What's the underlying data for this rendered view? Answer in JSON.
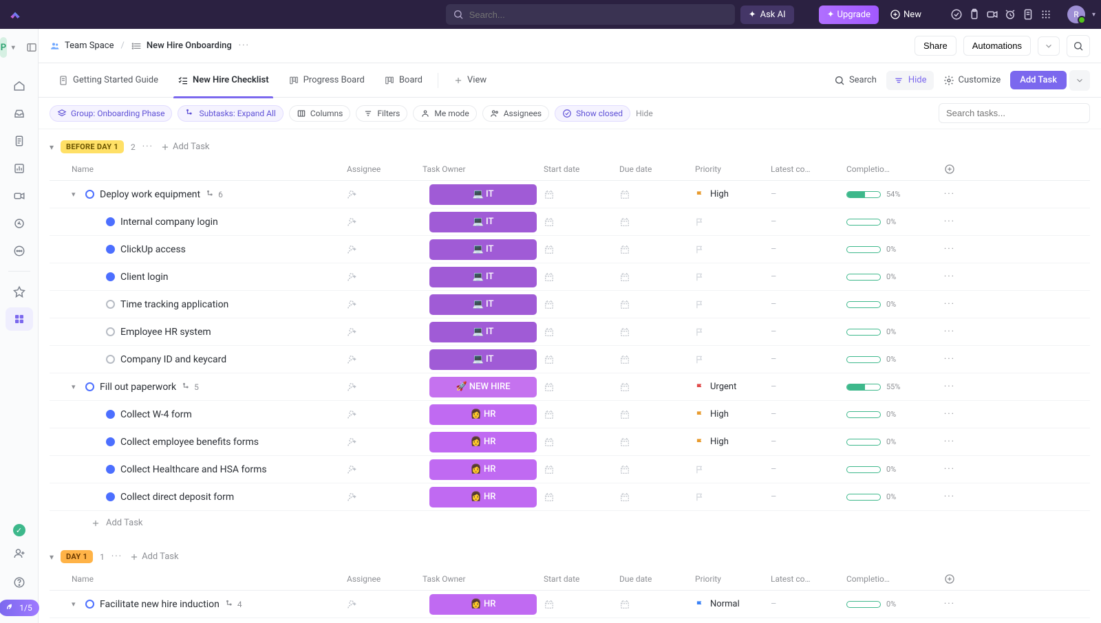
{
  "top": {
    "search_placeholder": "Search...",
    "ask_ai": "Ask AI",
    "upgrade": "Upgrade",
    "new": "New",
    "avatar_initial": "R"
  },
  "workspace_initial": "P",
  "breadcrumb": {
    "team_space": "Team Space",
    "list_name": "New Hire Onboarding",
    "share": "Share",
    "automations": "Automations"
  },
  "tabs": {
    "getting_started": "Getting Started Guide",
    "checklist": "New Hire Checklist",
    "progress_board": "Progress Board",
    "board": "Board",
    "view": "View",
    "search": "Search",
    "hide": "Hide",
    "customize": "Customize",
    "add_task": "Add Task"
  },
  "filters": {
    "group": "Group: Onboarding Phase",
    "subtasks": "Subtasks: Expand All",
    "columns": "Columns",
    "filters": "Filters",
    "me_mode": "Me mode",
    "assignees": "Assignees",
    "show_closed": "Show closed",
    "hide": "Hide",
    "search_placeholder": "Search tasks..."
  },
  "groups": [
    {
      "label": "BEFORE DAY 1",
      "badge_class": "",
      "count": "2",
      "add_task": "Add Task",
      "columns": {
        "name": "Name",
        "assignee": "Assignee",
        "owner": "Task Owner",
        "start": "Start date",
        "due": "Due date",
        "priority": "Priority",
        "latest": "Latest co…",
        "completion": "Completio…"
      },
      "rows": [
        {
          "indent": 0,
          "caret": true,
          "dot": "blue-ring",
          "name": "Deploy work equipment",
          "subcount": "6",
          "owner": "💻 IT",
          "owner_class": "owner-it",
          "flag": "orange",
          "prio": "High",
          "percent": 54
        },
        {
          "indent": 1,
          "dot": "blue-filled",
          "name": "Internal company login",
          "owner": "💻 IT",
          "owner_class": "owner-it",
          "flag": "empty",
          "percent": 0
        },
        {
          "indent": 1,
          "dot": "blue-filled",
          "name": "ClickUp access",
          "owner": "💻 IT",
          "owner_class": "owner-it",
          "flag": "empty",
          "percent": 0
        },
        {
          "indent": 1,
          "dot": "blue-filled",
          "name": "Client login",
          "owner": "💻 IT",
          "owner_class": "owner-it",
          "flag": "empty",
          "percent": 0
        },
        {
          "indent": 1,
          "dot": "grey",
          "name": "Time tracking application",
          "owner": "💻 IT",
          "owner_class": "owner-it",
          "flag": "empty",
          "percent": 0
        },
        {
          "indent": 1,
          "dot": "grey",
          "name": "Employee HR system",
          "owner": "💻 IT",
          "owner_class": "owner-it",
          "flag": "empty",
          "percent": 0
        },
        {
          "indent": 1,
          "dot": "grey",
          "name": "Company ID and keycard",
          "owner": "💻 IT",
          "owner_class": "owner-it",
          "flag": "empty",
          "percent": 0
        },
        {
          "indent": 0,
          "caret": true,
          "dot": "blue-ring",
          "name": "Fill out paperwork",
          "subcount": "5",
          "owner": "🚀 NEW HIRE",
          "owner_class": "owner-nh",
          "flag": "red",
          "prio": "Urgent",
          "percent": 55
        },
        {
          "indent": 1,
          "dot": "blue-filled",
          "name": "Collect W-4 form",
          "owner": "👩 HR",
          "owner_class": "owner-hr",
          "flag": "orange",
          "prio": "High",
          "percent": 0
        },
        {
          "indent": 1,
          "dot": "blue-filled",
          "name": "Collect employee benefits forms",
          "owner": "👩 HR",
          "owner_class": "owner-hr",
          "flag": "orange",
          "prio": "High",
          "percent": 0
        },
        {
          "indent": 1,
          "dot": "blue-filled",
          "name": "Collect Healthcare and HSA forms",
          "owner": "👩 HR",
          "owner_class": "owner-hr",
          "flag": "empty",
          "percent": 0
        },
        {
          "indent": 1,
          "dot": "blue-filled",
          "name": "Collect direct deposit form",
          "owner": "👩 HR",
          "owner_class": "owner-hr",
          "flag": "empty",
          "percent": 0
        }
      ],
      "footer_add": "Add Task"
    },
    {
      "label": "DAY 1",
      "badge_class": "orange",
      "count": "1",
      "add_task": "Add Task",
      "columns": {
        "name": "Name",
        "assignee": "Assignee",
        "owner": "Task Owner",
        "start": "Start date",
        "due": "Due date",
        "priority": "Priority",
        "latest": "Latest co…",
        "completion": "Completio…"
      },
      "rows": [
        {
          "indent": 0,
          "caret": true,
          "dot": "blue-ring",
          "name": "Facilitate new hire induction",
          "subcount": "4",
          "owner": "👩 HR",
          "owner_class": "owner-hr",
          "flag": "blue",
          "prio": "Normal",
          "percent": 0,
          "partial": true
        }
      ]
    }
  ],
  "help_progress": "1/5"
}
